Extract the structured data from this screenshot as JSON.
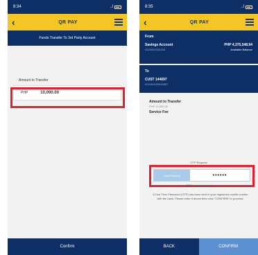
{
  "left": {
    "status": {
      "time": "8:34",
      "signal": "..l"
    },
    "appbar": {
      "title": "QR PAY",
      "back_icon": "chevron-left-icon",
      "menu_icon": "hamburger-menu-icon"
    },
    "subheader": "Funds Transfer To 3rd Party Account",
    "amount": {
      "label": "Amount to Transfer",
      "currency": "PHP",
      "value": "10,000.00"
    },
    "confirm_label": "Confirm"
  },
  "right": {
    "status": {
      "time": "8:35",
      "signal": "..l"
    },
    "appbar": {
      "title": "QR PAY",
      "back_icon": "chevron-left-icon",
      "menu_icon": "hamburger-menu-icon"
    },
    "from": {
      "heading": "From",
      "account_name": "Savings Account",
      "account_number": "0024001023155",
      "balance": "PHP 4,375,548.94",
      "balance_label": "Available Balance"
    },
    "to": {
      "heading": "To",
      "account_name": "CUST 144697",
      "account_number": "002400100234567"
    },
    "amount": {
      "label": "Amount to Transfer",
      "value": "PHP 10,000.00"
    },
    "service_fee": {
      "label": "Service Fee",
      "value": ""
    },
    "otp": {
      "title": "OTP Request",
      "button_label": "Click Resend",
      "value": "••••••",
      "remaining": "(238 secs remaining)",
      "note": "A One Time Password (OTP) has been sent to your registered mobile number with the bank. Please enter it above then click \"CONFIRM\" to proceed."
    },
    "back_label": "BACK",
    "confirm_label": "CONFIRM"
  },
  "colors": {
    "navy": "#0d2f66",
    "yellow": "#f3c623",
    "highlight": "#e0202e",
    "confirm_blue": "#5b8fd0"
  }
}
